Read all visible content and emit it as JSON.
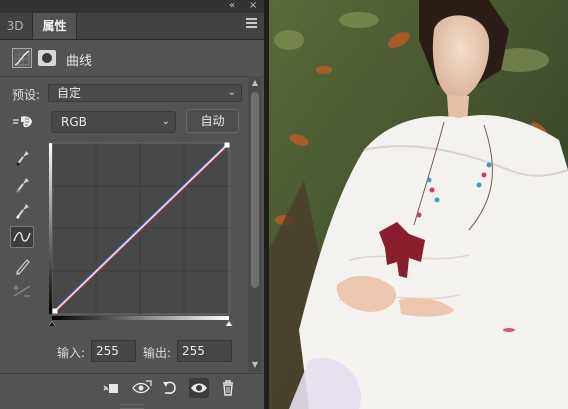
{
  "window": {
    "collapse_glyph": "«",
    "close_glyph": "×"
  },
  "tabs": [
    {
      "label": "3D",
      "active": false
    },
    {
      "label": "属性",
      "active": true
    }
  ],
  "properties": {
    "header_title": "曲线",
    "header_icons": [
      "curves-adjustment-icon",
      "layer-mask-icon"
    ],
    "preset_label": "预设:",
    "preset_value": "自定",
    "channel_value": "RGB",
    "auto_button": "自动",
    "tools": [
      "on-image-adjust-icon",
      "black-point-eyedropper-icon",
      "gray-point-eyedropper-icon",
      "white-point-eyedropper-icon",
      "curve-point-tool-icon",
      "pencil-draw-icon",
      "smooth-curve-icon"
    ],
    "input_label": "输入:",
    "input_value": "255",
    "output_label": "输出:",
    "output_value": "255"
  },
  "curve": {
    "points": [
      [
        0,
        0
      ],
      [
        255,
        255
      ]
    ],
    "colors": {
      "rgb": "#ffffff",
      "red": "#ff5a5a",
      "blue": "#4f8dff"
    }
  },
  "bottom_toolbar": [
    "clip-to-layer-icon",
    "view-previous-state-icon",
    "reset-icon",
    "visibility-eye-icon",
    "trash-icon"
  ],
  "colors": {
    "panel": "#535353",
    "tabbar": "#424242",
    "graph_bg": "#484848",
    "accent": "#4f8dff"
  }
}
